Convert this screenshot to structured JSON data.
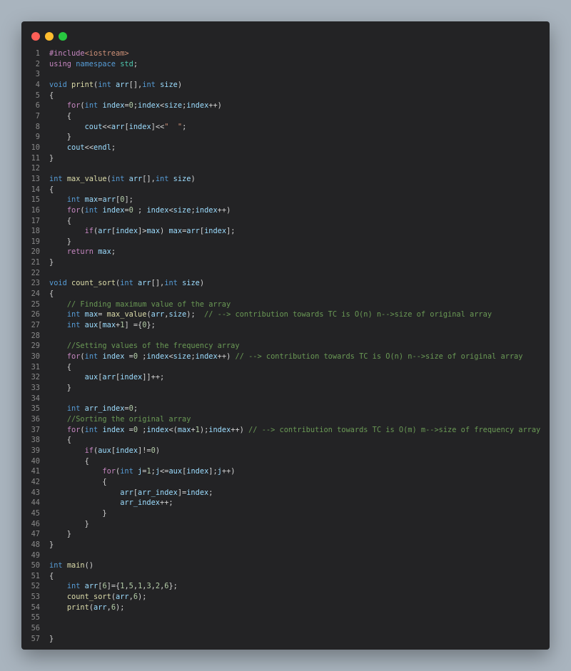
{
  "window": {
    "controls": [
      {
        "name": "close-button",
        "color": "#ff5f57"
      },
      {
        "name": "minimize-button",
        "color": "#febc2e"
      },
      {
        "name": "maximize-button",
        "color": "#28c840"
      }
    ]
  },
  "colors": {
    "background": "#a9b4be",
    "editor": "#232325",
    "keyword": "#569cd6",
    "control": "#c586c0",
    "string": "#ce9178",
    "number": "#b5cea8",
    "comment": "#6a9955",
    "variable": "#9cdcfe",
    "function": "#dcdcaa",
    "type": "#4ec9b0"
  },
  "code_lines": [
    [
      [
        "ctl",
        "#include"
      ],
      [
        "str",
        "<iostream>"
      ]
    ],
    [
      [
        "ctl",
        "using"
      ],
      [
        "p",
        " "
      ],
      [
        "kw",
        "namespace"
      ],
      [
        "p",
        " "
      ],
      [
        "typ",
        "std"
      ],
      [
        "p",
        ";"
      ]
    ],
    [],
    [
      [
        "kw",
        "void"
      ],
      [
        "p",
        " "
      ],
      [
        "fn",
        "print"
      ],
      [
        "p",
        "("
      ],
      [
        "kw",
        "int"
      ],
      [
        "p",
        " "
      ],
      [
        "var",
        "arr"
      ],
      [
        "p",
        "[],"
      ],
      [
        "kw",
        "int"
      ],
      [
        "p",
        " "
      ],
      [
        "var",
        "size"
      ],
      [
        "p",
        ")"
      ]
    ],
    [
      [
        "p",
        "{"
      ]
    ],
    [
      [
        "p",
        "    "
      ],
      [
        "ctl",
        "for"
      ],
      [
        "p",
        "("
      ],
      [
        "kw",
        "int"
      ],
      [
        "p",
        " "
      ],
      [
        "var",
        "index"
      ],
      [
        "p",
        "="
      ],
      [
        "num",
        "0"
      ],
      [
        "p",
        ";"
      ],
      [
        "var",
        "index"
      ],
      [
        "p",
        "<"
      ],
      [
        "var",
        "size"
      ],
      [
        "p",
        ";"
      ],
      [
        "var",
        "index"
      ],
      [
        "p",
        "++)"
      ]
    ],
    [
      [
        "p",
        "    {"
      ]
    ],
    [
      [
        "p",
        "        "
      ],
      [
        "var",
        "cout"
      ],
      [
        "p",
        "<<"
      ],
      [
        "var",
        "arr"
      ],
      [
        "p",
        "["
      ],
      [
        "var",
        "index"
      ],
      [
        "p",
        "]<<"
      ],
      [
        "str",
        "\"  \""
      ],
      [
        "p",
        ";"
      ]
    ],
    [
      [
        "p",
        "    }"
      ]
    ],
    [
      [
        "p",
        "    "
      ],
      [
        "var",
        "cout"
      ],
      [
        "p",
        "<<"
      ],
      [
        "var",
        "endl"
      ],
      [
        "p",
        ";"
      ]
    ],
    [
      [
        "p",
        "}"
      ]
    ],
    [],
    [
      [
        "kw",
        "int"
      ],
      [
        "p",
        " "
      ],
      [
        "fn",
        "max_value"
      ],
      [
        "p",
        "("
      ],
      [
        "kw",
        "int"
      ],
      [
        "p",
        " "
      ],
      [
        "var",
        "arr"
      ],
      [
        "p",
        "[],"
      ],
      [
        "kw",
        "int"
      ],
      [
        "p",
        " "
      ],
      [
        "var",
        "size"
      ],
      [
        "p",
        ")"
      ]
    ],
    [
      [
        "p",
        "{"
      ]
    ],
    [
      [
        "p",
        "    "
      ],
      [
        "kw",
        "int"
      ],
      [
        "p",
        " "
      ],
      [
        "var",
        "max"
      ],
      [
        "p",
        "="
      ],
      [
        "var",
        "arr"
      ],
      [
        "p",
        "["
      ],
      [
        "num",
        "0"
      ],
      [
        "p",
        "];"
      ]
    ],
    [
      [
        "p",
        "    "
      ],
      [
        "ctl",
        "for"
      ],
      [
        "p",
        "("
      ],
      [
        "kw",
        "int"
      ],
      [
        "p",
        " "
      ],
      [
        "var",
        "index"
      ],
      [
        "p",
        "="
      ],
      [
        "num",
        "0"
      ],
      [
        "p",
        " ; "
      ],
      [
        "var",
        "index"
      ],
      [
        "p",
        "<"
      ],
      [
        "var",
        "size"
      ],
      [
        "p",
        ";"
      ],
      [
        "var",
        "index"
      ],
      [
        "p",
        "++)"
      ]
    ],
    [
      [
        "p",
        "    {"
      ]
    ],
    [
      [
        "p",
        "        "
      ],
      [
        "ctl",
        "if"
      ],
      [
        "p",
        "("
      ],
      [
        "var",
        "arr"
      ],
      [
        "p",
        "["
      ],
      [
        "var",
        "index"
      ],
      [
        "p",
        "]>"
      ],
      [
        "var",
        "max"
      ],
      [
        "p",
        ") "
      ],
      [
        "var",
        "max"
      ],
      [
        "p",
        "="
      ],
      [
        "var",
        "arr"
      ],
      [
        "p",
        "["
      ],
      [
        "var",
        "index"
      ],
      [
        "p",
        "];"
      ]
    ],
    [
      [
        "p",
        "    }"
      ]
    ],
    [
      [
        "p",
        "    "
      ],
      [
        "ctl",
        "return"
      ],
      [
        "p",
        " "
      ],
      [
        "var",
        "max"
      ],
      [
        "p",
        ";"
      ]
    ],
    [
      [
        "p",
        "}"
      ]
    ],
    [],
    [
      [
        "kw",
        "void"
      ],
      [
        "p",
        " "
      ],
      [
        "fn",
        "count_sort"
      ],
      [
        "p",
        "("
      ],
      [
        "kw",
        "int"
      ],
      [
        "p",
        " "
      ],
      [
        "var",
        "arr"
      ],
      [
        "p",
        "[],"
      ],
      [
        "kw",
        "int"
      ],
      [
        "p",
        " "
      ],
      [
        "var",
        "size"
      ],
      [
        "p",
        ")"
      ]
    ],
    [
      [
        "p",
        "{"
      ]
    ],
    [
      [
        "p",
        "    "
      ],
      [
        "cmt",
        "// Finding maximum value of the array"
      ]
    ],
    [
      [
        "p",
        "    "
      ],
      [
        "kw",
        "int"
      ],
      [
        "p",
        " "
      ],
      [
        "var",
        "max"
      ],
      [
        "p",
        "= "
      ],
      [
        "fn",
        "max_value"
      ],
      [
        "p",
        "("
      ],
      [
        "var",
        "arr"
      ],
      [
        "p",
        ","
      ],
      [
        "var",
        "size"
      ],
      [
        "p",
        ");  "
      ],
      [
        "cmt",
        "// --> contribution towards TC is O(n) n-->size of original array"
      ]
    ],
    [
      [
        "p",
        "    "
      ],
      [
        "kw",
        "int"
      ],
      [
        "p",
        " "
      ],
      [
        "var",
        "aux"
      ],
      [
        "p",
        "["
      ],
      [
        "var",
        "max"
      ],
      [
        "p",
        "+"
      ],
      [
        "num",
        "1"
      ],
      [
        "p",
        "] ={"
      ],
      [
        "num",
        "0"
      ],
      [
        "p",
        "};"
      ]
    ],
    [],
    [
      [
        "p",
        "    "
      ],
      [
        "cmt",
        "//Setting values of the frequency array"
      ]
    ],
    [
      [
        "p",
        "    "
      ],
      [
        "ctl",
        "for"
      ],
      [
        "p",
        "("
      ],
      [
        "kw",
        "int"
      ],
      [
        "p",
        " "
      ],
      [
        "var",
        "index"
      ],
      [
        "p",
        " ="
      ],
      [
        "num",
        "0"
      ],
      [
        "p",
        " ;"
      ],
      [
        "var",
        "index"
      ],
      [
        "p",
        "<"
      ],
      [
        "var",
        "size"
      ],
      [
        "p",
        ";"
      ],
      [
        "var",
        "index"
      ],
      [
        "p",
        "++) "
      ],
      [
        "cmt",
        "// --> contribution towards TC is O(n) n-->size of original array"
      ]
    ],
    [
      [
        "p",
        "    {"
      ]
    ],
    [
      [
        "p",
        "        "
      ],
      [
        "var",
        "aux"
      ],
      [
        "p",
        "["
      ],
      [
        "var",
        "arr"
      ],
      [
        "p",
        "["
      ],
      [
        "var",
        "index"
      ],
      [
        "p",
        "]]++;"
      ]
    ],
    [
      [
        "p",
        "    }"
      ]
    ],
    [],
    [
      [
        "p",
        "    "
      ],
      [
        "kw",
        "int"
      ],
      [
        "p",
        " "
      ],
      [
        "var",
        "arr_index"
      ],
      [
        "p",
        "="
      ],
      [
        "num",
        "0"
      ],
      [
        "p",
        ";"
      ]
    ],
    [
      [
        "p",
        "    "
      ],
      [
        "cmt",
        "//Sorting the original array"
      ]
    ],
    [
      [
        "p",
        "    "
      ],
      [
        "ctl",
        "for"
      ],
      [
        "p",
        "("
      ],
      [
        "kw",
        "int"
      ],
      [
        "p",
        " "
      ],
      [
        "var",
        "index"
      ],
      [
        "p",
        " ="
      ],
      [
        "num",
        "0"
      ],
      [
        "p",
        " ;"
      ],
      [
        "var",
        "index"
      ],
      [
        "p",
        "<("
      ],
      [
        "var",
        "max"
      ],
      [
        "p",
        "+"
      ],
      [
        "num",
        "1"
      ],
      [
        "p",
        ");"
      ],
      [
        "var",
        "index"
      ],
      [
        "p",
        "++) "
      ],
      [
        "cmt",
        "// --> contribution towards TC is O(m) m-->size of frequency array"
      ]
    ],
    [
      [
        "p",
        "    {"
      ]
    ],
    [
      [
        "p",
        "        "
      ],
      [
        "ctl",
        "if"
      ],
      [
        "p",
        "("
      ],
      [
        "var",
        "aux"
      ],
      [
        "p",
        "["
      ],
      [
        "var",
        "index"
      ],
      [
        "p",
        "]!="
      ],
      [
        "num",
        "0"
      ],
      [
        "p",
        ")"
      ]
    ],
    [
      [
        "p",
        "        {"
      ]
    ],
    [
      [
        "p",
        "            "
      ],
      [
        "ctl",
        "for"
      ],
      [
        "p",
        "("
      ],
      [
        "kw",
        "int"
      ],
      [
        "p",
        " "
      ],
      [
        "var",
        "j"
      ],
      [
        "p",
        "="
      ],
      [
        "num",
        "1"
      ],
      [
        "p",
        ";"
      ],
      [
        "var",
        "j"
      ],
      [
        "p",
        "<="
      ],
      [
        "var",
        "aux"
      ],
      [
        "p",
        "["
      ],
      [
        "var",
        "index"
      ],
      [
        "p",
        "];"
      ],
      [
        "var",
        "j"
      ],
      [
        "p",
        "++)"
      ]
    ],
    [
      [
        "p",
        "            {"
      ]
    ],
    [
      [
        "p",
        "                "
      ],
      [
        "var",
        "arr"
      ],
      [
        "p",
        "["
      ],
      [
        "var",
        "arr_index"
      ],
      [
        "p",
        "]="
      ],
      [
        "var",
        "index"
      ],
      [
        "p",
        ";"
      ]
    ],
    [
      [
        "p",
        "                "
      ],
      [
        "var",
        "arr_index"
      ],
      [
        "p",
        "++;"
      ]
    ],
    [
      [
        "p",
        "            }"
      ]
    ],
    [
      [
        "p",
        "        }"
      ]
    ],
    [
      [
        "p",
        "    }"
      ]
    ],
    [
      [
        "p",
        "}"
      ]
    ],
    [],
    [
      [
        "kw",
        "int"
      ],
      [
        "p",
        " "
      ],
      [
        "fn",
        "main"
      ],
      [
        "p",
        "()"
      ]
    ],
    [
      [
        "p",
        "{"
      ]
    ],
    [
      [
        "p",
        "    "
      ],
      [
        "kw",
        "int"
      ],
      [
        "p",
        " "
      ],
      [
        "var",
        "arr"
      ],
      [
        "p",
        "["
      ],
      [
        "num",
        "6"
      ],
      [
        "p",
        "]={"
      ],
      [
        "num",
        "1"
      ],
      [
        "p",
        ","
      ],
      [
        "num",
        "5"
      ],
      [
        "p",
        ","
      ],
      [
        "num",
        "1"
      ],
      [
        "p",
        ","
      ],
      [
        "num",
        "3"
      ],
      [
        "p",
        ","
      ],
      [
        "num",
        "2"
      ],
      [
        "p",
        ","
      ],
      [
        "num",
        "6"
      ],
      [
        "p",
        "};"
      ]
    ],
    [
      [
        "p",
        "    "
      ],
      [
        "fn",
        "count_sort"
      ],
      [
        "p",
        "("
      ],
      [
        "var",
        "arr"
      ],
      [
        "p",
        ","
      ],
      [
        "num",
        "6"
      ],
      [
        "p",
        ");"
      ]
    ],
    [
      [
        "p",
        "    "
      ],
      [
        "fn",
        "print"
      ],
      [
        "p",
        "("
      ],
      [
        "var",
        "arr"
      ],
      [
        "p",
        ","
      ],
      [
        "num",
        "6"
      ],
      [
        "p",
        ");"
      ]
    ],
    [],
    [],
    [
      [
        "p",
        "}"
      ]
    ]
  ]
}
